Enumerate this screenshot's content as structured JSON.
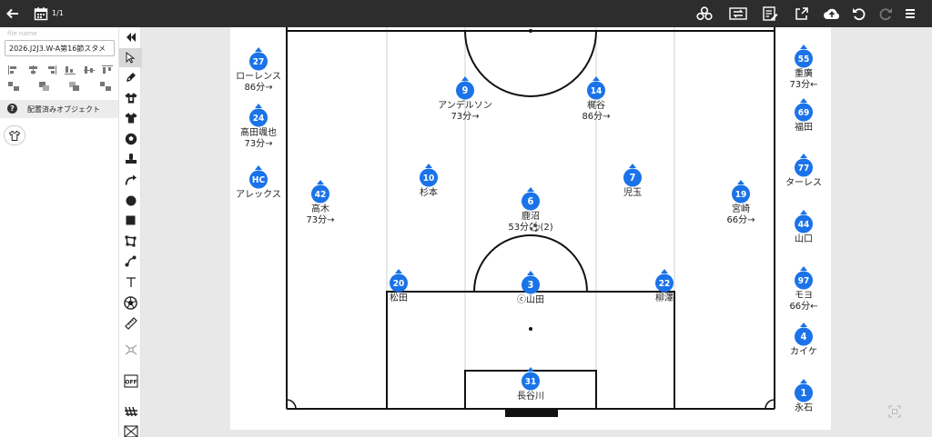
{
  "topbar": {
    "page_count": "1/1",
    "icons": [
      "back-arrow-icon",
      "calendar-icon",
      "share-nodes-icon",
      "swap-icon",
      "edit-list-icon",
      "export-icon",
      "cloud-upload-icon",
      "undo-icon",
      "redo-icon",
      "menu-icon"
    ]
  },
  "file": {
    "label": "file name",
    "value": "2026.J2J3.W-A第16節スタメ"
  },
  "left_panel": {
    "placed_objects_label": "配置済みオブジェクト"
  },
  "tools": [
    "collapse",
    "select",
    "pen",
    "shirt-outline",
    "shirt-solid",
    "ball",
    "cone",
    "curve-arrow",
    "circle",
    "square",
    "shape",
    "path",
    "text",
    "ball-outline",
    "ruler",
    "grid",
    "off",
    "ladder",
    "grid2"
  ],
  "team_color": "#1a73e8",
  "players": [
    {
      "id": "p27",
      "number": "27",
      "name": "ローレンス",
      "sub": "86分→"
    },
    {
      "id": "p24",
      "number": "24",
      "name": "髙田颯也",
      "sub": "73分→"
    },
    {
      "id": "hc",
      "number": "HC",
      "name": "アレックス",
      "sub": ""
    },
    {
      "id": "p9",
      "number": "9",
      "name": "アンデルソン",
      "sub": "73分→"
    },
    {
      "id": "p14",
      "number": "14",
      "name": "梶谷",
      "sub": "86分→"
    },
    {
      "id": "p10",
      "number": "10",
      "name": "杉本",
      "sub": ""
    },
    {
      "id": "p7",
      "number": "7",
      "name": "児玉",
      "sub": ""
    },
    {
      "id": "p6",
      "number": "6",
      "name": "鹿沼",
      "sub": "53分⚽(2)"
    },
    {
      "id": "p42",
      "number": "42",
      "name": "高木",
      "sub": "73分→"
    },
    {
      "id": "p19",
      "number": "19",
      "name": "宮崎",
      "sub": "66分→"
    },
    {
      "id": "p20",
      "number": "20",
      "name": "松田",
      "sub": ""
    },
    {
      "id": "p3",
      "number": "3",
      "name": "ⓒ山田",
      "sub": ""
    },
    {
      "id": "p22",
      "number": "22",
      "name": "柳澤",
      "sub": ""
    },
    {
      "id": "p31",
      "number": "31",
      "name": "長谷川",
      "sub": ""
    },
    {
      "id": "p55",
      "number": "55",
      "name": "重廣",
      "sub": "73分←"
    },
    {
      "id": "p69",
      "number": "69",
      "name": "福田",
      "sub": ""
    },
    {
      "id": "p77",
      "number": "77",
      "name": "ターレス",
      "sub": ""
    },
    {
      "id": "p44",
      "number": "44",
      "name": "山口",
      "sub": ""
    },
    {
      "id": "p97",
      "number": "97",
      "name": "モヨ",
      "sub": "66分←"
    },
    {
      "id": "p4",
      "number": "4",
      "name": "カイケ",
      "sub": ""
    },
    {
      "id": "p1",
      "number": "1",
      "name": "永石",
      "sub": ""
    }
  ]
}
